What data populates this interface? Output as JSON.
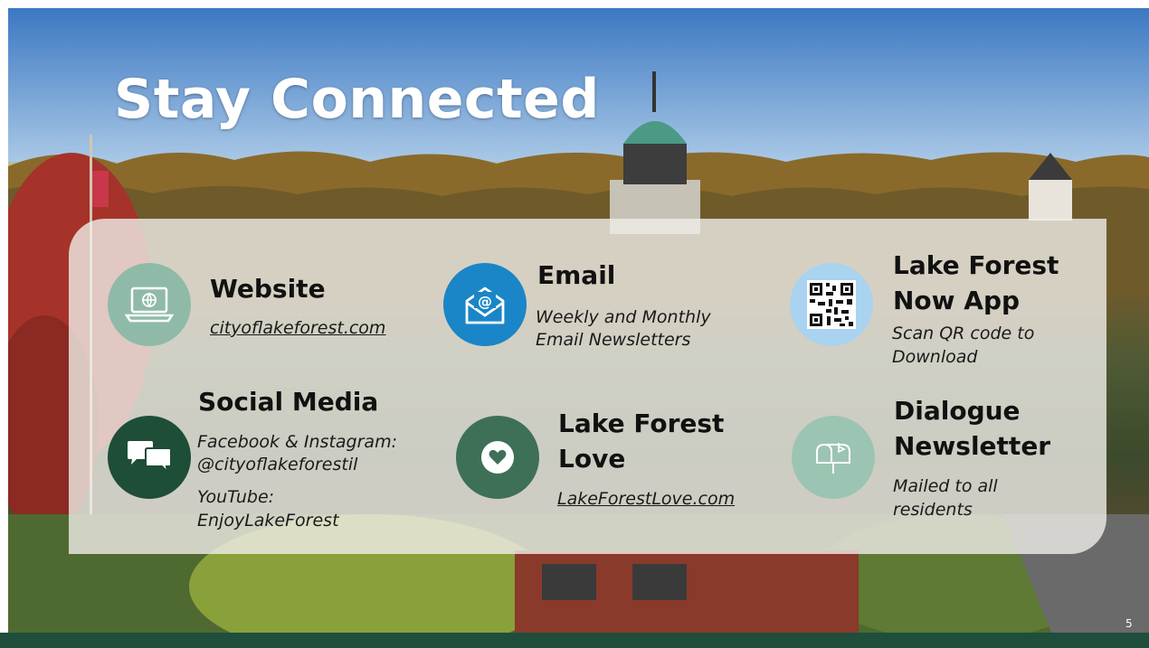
{
  "slide": {
    "title": "Stay Connected",
    "page_number": "5"
  },
  "items": {
    "website": {
      "heading": "Website",
      "link": "cityoflakeforest.com",
      "icon": "laptop-globe-icon",
      "color": "#8fbaa8"
    },
    "email": {
      "heading": "Email",
      "line1": "Weekly and Monthly",
      "line2": "Email Newsletters",
      "icon": "envelope-at-icon",
      "color": "#1a86c7"
    },
    "app": {
      "heading_line1": "Lake Forest",
      "heading_line2": "Now App",
      "line1": "Scan QR code to",
      "line2": "Download",
      "icon": "qr-code-icon",
      "color": "#a9d3ef"
    },
    "social": {
      "heading": "Social Media",
      "line1": "Facebook & Instagram:",
      "line2": "@cityoflakeforestil",
      "line3": "YouTube:",
      "line4": "EnjoyLakeForest",
      "icon": "chat-bubbles-icon",
      "color": "#1e4d38"
    },
    "love": {
      "heading_line1": "Lake Forest",
      "heading_line2": "Love",
      "link": "LakeForestLove.com",
      "icon": "heart-icon",
      "color": "#3e7058"
    },
    "dialogue": {
      "heading_line1": "Dialogue",
      "heading_line2": "Newsletter",
      "line1": "Mailed to all",
      "line2": "residents",
      "icon": "mailbox-icon",
      "color": "#9cc4b2"
    }
  }
}
